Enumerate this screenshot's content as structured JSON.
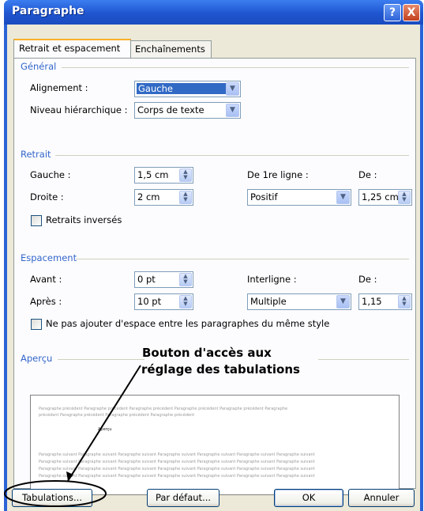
{
  "window": {
    "title": "Paragraphe",
    "help_icon": "?",
    "close_icon": "X"
  },
  "tabs": [
    {
      "label": "Retrait et espacement"
    },
    {
      "label": "Enchaînements"
    }
  ],
  "general": {
    "heading": "Général",
    "alignment_label": "Alignement :",
    "alignment_value": "Gauche",
    "level_label": "Niveau hiérarchique :",
    "level_value": "Corps de texte"
  },
  "indent": {
    "heading": "Retrait",
    "left_label": "Gauche :",
    "left_value": "1,5 cm",
    "right_label": "Droite :",
    "right_value": "2 cm",
    "first_line_label": "De 1re ligne :",
    "first_line_value": "Positif",
    "by_label": "De :",
    "by_value": "1,25 cm",
    "mirror_label": "Retraits inversés"
  },
  "spacing": {
    "heading": "Espacement",
    "before_label": "Avant :",
    "before_value": "0 pt",
    "after_label": "Après :",
    "after_value": "10 pt",
    "line_label": "Interligne :",
    "line_value": "Multiple",
    "at_label": "De :",
    "at_value": "1,15",
    "no_space_label": "Ne pas ajouter d'espace entre les paragraphes du même style"
  },
  "preview": {
    "heading": "Aperçu",
    "previous_text": "Paragraphe précédent Paragraphe précédent Paragraphe précédent Paragraphe précédent Paragraphe précédent Paragraphe",
    "previous_text2": "précédent Paragraphe précédent Paragraphe précédent Paragraphe précédent",
    "sample_text": "Aperçu",
    "following_text": "Paragraphe suivant Paragraphe suivant Paragraphe suivant Paragraphe suivant Paragraphe suivant Paragraphe suivant Paragraphe suivant"
  },
  "buttons": {
    "tabs": "Tabulations...",
    "default": "Par défaut...",
    "ok": "OK",
    "cancel": "Annuler"
  },
  "annotation": {
    "line1": "Bouton d'accès aux",
    "line2": "réglage des tabulations"
  }
}
